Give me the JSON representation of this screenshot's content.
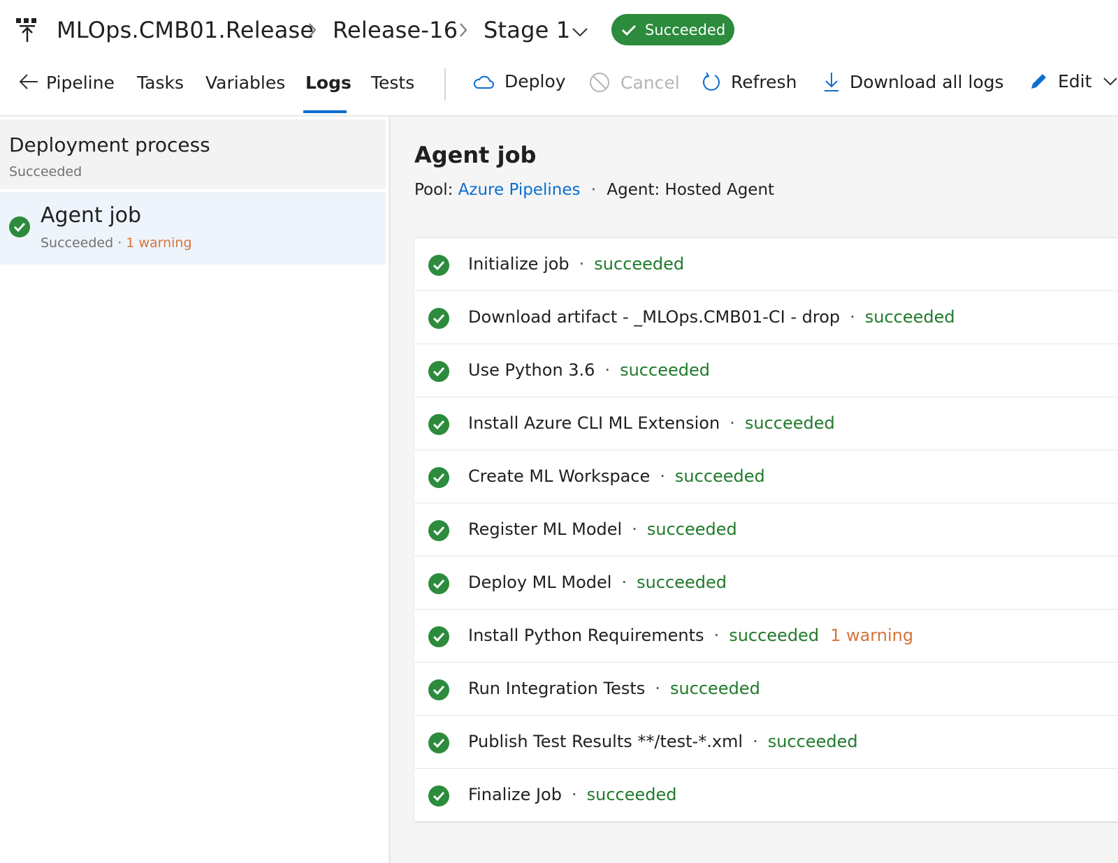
{
  "header": {
    "breadcrumb": [
      "MLOps.CMB01.Release",
      "Release-16",
      "Stage 1"
    ],
    "status": "Succeeded"
  },
  "tabs": {
    "pipeline": "Pipeline",
    "tasks": "Tasks",
    "variables": "Variables",
    "logs": "Logs",
    "tests": "Tests",
    "active": "Logs"
  },
  "toolbar": {
    "deploy": "Deploy",
    "cancel": "Cancel",
    "refresh": "Refresh",
    "download": "Download all logs",
    "edit": "Edit"
  },
  "left": {
    "process_title": "Deployment process",
    "process_status": "Succeeded",
    "job_title": "Agent job",
    "job_status": "Succeeded",
    "job_sep": "·",
    "job_warning": "1 warning"
  },
  "main": {
    "title": "Agent job",
    "pool_label": "Pool:",
    "pool_value": "Azure Pipelines",
    "sep": "·",
    "agent_text": "Agent: Hosted Agent",
    "steps": [
      {
        "name": "Initialize job",
        "status": "succeeded",
        "warning": ""
      },
      {
        "name": "Download artifact - _MLOps.CMB01-CI - drop",
        "status": "succeeded",
        "warning": ""
      },
      {
        "name": "Use Python 3.6",
        "status": "succeeded",
        "warning": ""
      },
      {
        "name": "Install Azure CLI ML Extension",
        "status": "succeeded",
        "warning": ""
      },
      {
        "name": "Create ML Workspace",
        "status": "succeeded",
        "warning": ""
      },
      {
        "name": "Register ML Model",
        "status": "succeeded",
        "warning": ""
      },
      {
        "name": "Deploy ML Model",
        "status": "succeeded",
        "warning": ""
      },
      {
        "name": "Install Python Requirements",
        "status": "succeeded",
        "warning": "1 warning"
      },
      {
        "name": "Run Integration Tests",
        "status": "succeeded",
        "warning": ""
      },
      {
        "name": "Publish Test Results **/test-*.xml",
        "status": "succeeded",
        "warning": ""
      },
      {
        "name": "Finalize Job",
        "status": "succeeded",
        "warning": ""
      }
    ]
  },
  "colors": {
    "success": "#2c8b3c",
    "success_text": "#1f7a2a",
    "warning": "#d6733b",
    "accent": "#0a6ecf"
  },
  "icons": {
    "app": "release-pipeline-icon",
    "step_status": "check-circle-icon"
  }
}
